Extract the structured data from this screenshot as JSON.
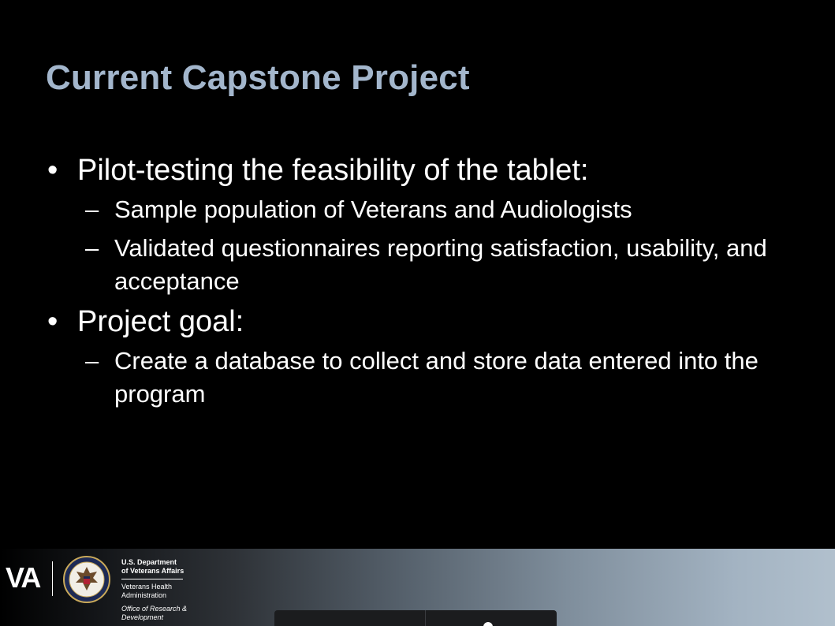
{
  "slide": {
    "title": "Current Capstone Project",
    "bullets": [
      {
        "text": "Pilot-testing the feasibility of the tablet:",
        "subs": [
          "Sample population of Veterans and Audiologists",
          "Validated questionnaires reporting satisfaction, usability, and acceptance"
        ]
      },
      {
        "text": "Project goal:",
        "subs": [
          "Create a database to collect and store data entered into the program"
        ]
      }
    ],
    "bullet_mark": "•",
    "sub_mark": "–"
  },
  "footer": {
    "va_logo": "VA",
    "department_line1": "U.S. Department",
    "department_line2": "of Veterans Affairs",
    "vha_line1": "Veterans Health",
    "vha_line2": "Administration",
    "ord_line1": "Office of Research &",
    "ord_line2": "Development",
    "seal_icon": "va-seal-icon"
  },
  "colors": {
    "title": "#a3b6cc",
    "background": "#000000",
    "text": "#ffffff",
    "footer_gradient_end": "#b1c0cd"
  }
}
